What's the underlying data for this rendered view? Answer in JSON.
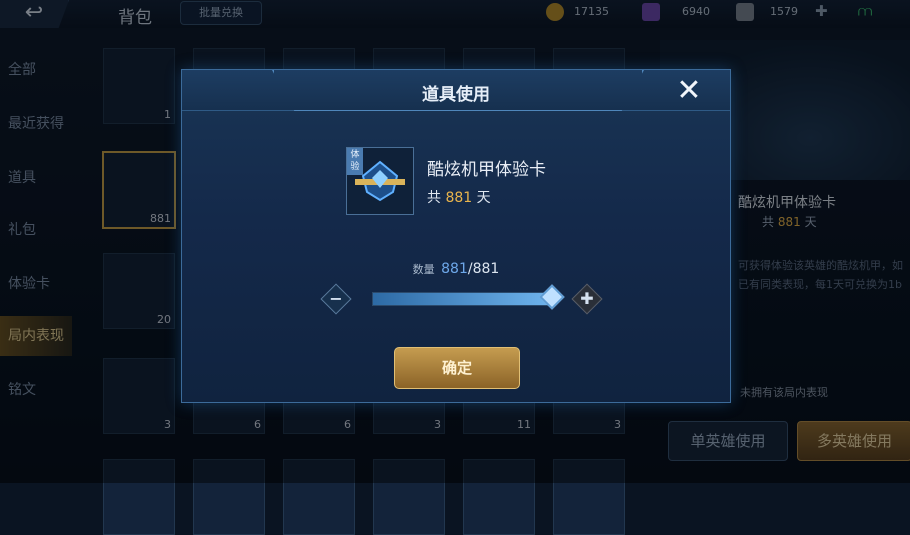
{
  "topbar": {
    "back_icon": "↩",
    "title": "背包",
    "exchange_label": "批量兑换",
    "gold": "17135",
    "gems": "6940",
    "tickets": "1579",
    "plus_icon": "✚",
    "signal_icon": "⩋"
  },
  "sidebar": {
    "items": [
      {
        "label": "全部"
      },
      {
        "label": "最近获得"
      },
      {
        "label": "道具"
      },
      {
        "label": "礼包"
      },
      {
        "label": "体验卡"
      },
      {
        "label": "局内表现"
      },
      {
        "label": "铭文"
      }
    ]
  },
  "grid": {
    "counts": [
      "1",
      "881",
      "20",
      "3",
      "6",
      "6",
      "3",
      "11",
      "3"
    ]
  },
  "detail": {
    "title": "酷炫机甲体验卡",
    "days_prefix": "共",
    "days_value": "881",
    "days_suffix": "天",
    "desc": "可获得体验该英雄的酷炫机甲，如已有同类表现，每1天可兑换为1b",
    "not_owned": "未拥有该局内表现",
    "single_btn": "单英雄使用",
    "multi_btn": "多英雄使用"
  },
  "dialog": {
    "title": "道具使用",
    "close_icon": "✕",
    "item_name": "酷炫机甲体验卡",
    "trial_badge": "体验",
    "days_prefix": "共",
    "days_value": "881",
    "days_suffix": "天",
    "qty_label": "数量",
    "qty_current": "881",
    "qty_max": "881",
    "qty_fraction": 1.0,
    "minus_icon": "−",
    "plus_icon": "✚",
    "confirm_label": "确定"
  },
  "colors": {
    "gold": "#e9b44c",
    "accent_blue": "#6ea8ea"
  }
}
